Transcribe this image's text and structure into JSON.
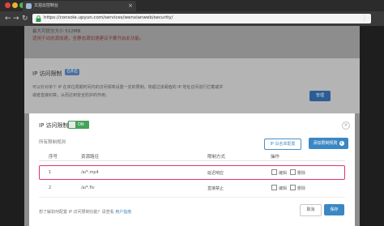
{
  "browser": {
    "tab_title": "又拍云控制台",
    "url": "https://console.upyun.com/services/wenxianweb/security/",
    "colors": {
      "close": "#e0443e",
      "min": "#e9b230",
      "max": "#4cbb40"
    }
  },
  "background_page": {
    "max_size_text": "最大可提交大小 512MB",
    "warning_text": "适用于动态源加速，全静态源加速建议不要开启此功能。",
    "ip_title": "IP 访问限制",
    "ip_badge": "已开启",
    "ip_desc_line1": "可以针对单个 IP 在单位周期时间内的访问频率设置一定的限制，将超过该阈值的 IP 地址访问进行拦截或并",
    "ip_desc_line2": "或者直接封禁，从而达到安全防护的作用。",
    "manage_label": "管理"
  },
  "modal": {
    "title": "IP 访问限制",
    "toggle_label": "ON",
    "subtitle": "所有限制规则",
    "config_button": "IP 白名单配置",
    "add_button": "添加限制规则",
    "columns": [
      "序号",
      "资源路径",
      "限制方式",
      "操作"
    ],
    "rows": [
      {
        "index": "1",
        "path": "/a/*.mp4",
        "method": "延迟响应",
        "edit": "编辑",
        "delete": "删除"
      },
      {
        "index": "2",
        "path": "/a/*.flv",
        "method": "直接禁止",
        "edit": "编辑",
        "delete": "删除"
      }
    ],
    "help_text": "想了解如何配置 IP 访问限制功能？请查看",
    "help_link": "用户指南",
    "cancel_label": "取消",
    "save_label": "保存",
    "accent_color": "#3b87c4",
    "highlight_color": "#e0336f"
  }
}
